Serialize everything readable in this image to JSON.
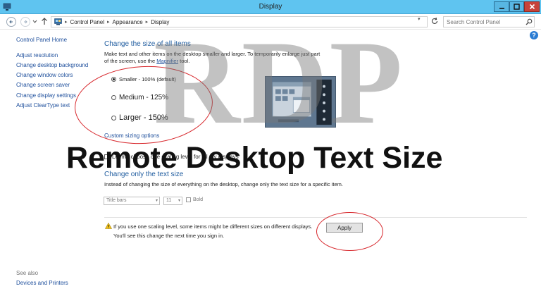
{
  "window": {
    "title": "Display"
  },
  "address": {
    "crumbs": [
      "Control Panel",
      "Appearance",
      "Display"
    ],
    "search_placeholder": "Search Control Panel"
  },
  "sidebar": {
    "home": "Control Panel Home",
    "items": [
      "Adjust resolution",
      "Change desktop background",
      "Change window colors",
      "Change screen saver",
      "Change display settings",
      "Adjust ClearType text"
    ],
    "see_also": "See also",
    "devices": "Devices and Printers"
  },
  "main": {
    "heading1": "Change the size of all items",
    "desc1_a": "Make text and other items on the desktop smaller and larger. To temporarily enlarge just part of the screen, use the ",
    "desc1_link": "Magnifier",
    "desc1_b": " tool.",
    "options": [
      {
        "label": "Smaller - 100% (default)",
        "selected": true
      },
      {
        "label": "Medium - 125%",
        "selected": false
      },
      {
        "label": "Larger - 150%",
        "selected": false
      }
    ],
    "custom_link": "Custom sizing options",
    "checkbox_label": "Let me choose one scaling level for all my displays",
    "heading2": "Change only the text size",
    "desc2": "Instead of changing the size of everything on the desktop, change only the text size for a specific item.",
    "item_select": "Title bars",
    "size_select": "11",
    "bold_label": "Bold",
    "warning_line1": "If you use one scaling level, some items might be different sizes on different displays.",
    "warning_line2": "You'll see this change the next time you sign in.",
    "apply": "Apply"
  },
  "overlay": {
    "watermark": "RDP",
    "title": "Remote Desktop Text Size"
  },
  "colors": {
    "titlebar": "#5fc4f0",
    "link": "#1e4f9c",
    "heading": "#1f5c9f",
    "annotation": "#d7262b"
  }
}
